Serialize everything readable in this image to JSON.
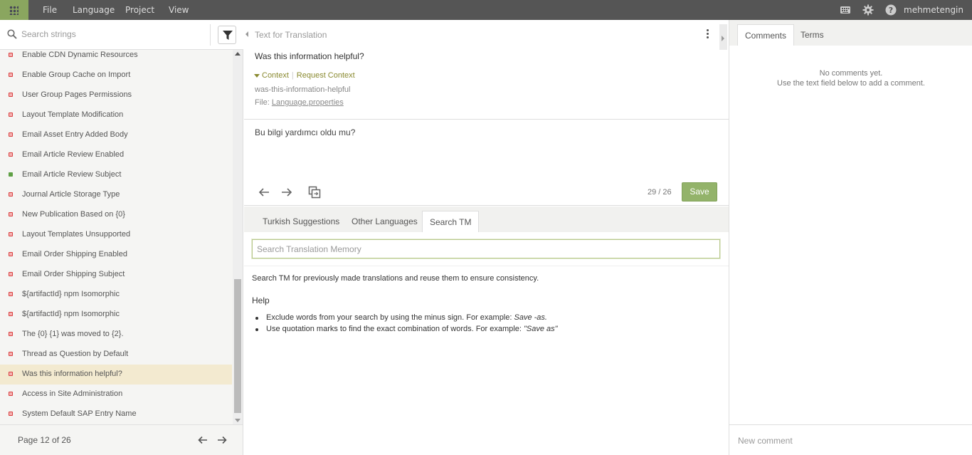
{
  "colors": {
    "topbar": "#555555",
    "accent": "#8aa65f",
    "save": "#93b36a",
    "selected_row": "#f3ead0",
    "untranslated": "#d94040",
    "translated": "#5fa045"
  },
  "menu": {
    "file": "File",
    "language": "Language",
    "project": "Project",
    "view": "View"
  },
  "topbar_icons": [
    "keyboard-icon",
    "gear-icon",
    "help-icon"
  ],
  "user": {
    "name": "mehmetengin"
  },
  "search": {
    "placeholder": "Search strings"
  },
  "strings": [
    {
      "label": "Enable CDN Dynamic Resources",
      "status": "untranslated"
    },
    {
      "label": "Enable Group Cache on Import",
      "status": "untranslated"
    },
    {
      "label": "User Group Pages Permissions",
      "status": "untranslated"
    },
    {
      "label": "Layout Template Modification",
      "status": "untranslated"
    },
    {
      "label": "Email Asset Entry Added Body",
      "status": "untranslated"
    },
    {
      "label": "Email Article Review Enabled",
      "status": "untranslated"
    },
    {
      "label": "Email Article Review Subject",
      "status": "translated"
    },
    {
      "label": "Journal Article Storage Type",
      "status": "untranslated"
    },
    {
      "label": "New Publication Based on {0}",
      "status": "untranslated"
    },
    {
      "label": "Layout Templates Unsupported",
      "status": "untranslated"
    },
    {
      "label": "Email Order Shipping Enabled",
      "status": "untranslated"
    },
    {
      "label": "Email Order Shipping Subject",
      "status": "untranslated"
    },
    {
      "label": "${artifactId} npm Isomorphic",
      "status": "untranslated"
    },
    {
      "label": "${artifactId} npm Isomorphic",
      "status": "untranslated"
    },
    {
      "label": "The {0} {1} was moved to {2}.",
      "status": "untranslated"
    },
    {
      "label": "Thread as Question by Default",
      "status": "untranslated"
    },
    {
      "label": "Was this information helpful?",
      "status": "untranslated",
      "selected": true
    },
    {
      "label": "Access in Site Administration",
      "status": "untranslated"
    },
    {
      "label": "System Default SAP Entry Name",
      "status": "untranslated"
    }
  ],
  "pager": {
    "label": "Page 12 of 26"
  },
  "source": {
    "header": "Text for Translation",
    "text": "Was this information helpful?",
    "context_label": "Context",
    "request_context_label": "Request Context",
    "key": "was-this-information-helpful",
    "file_prefix": "File:",
    "file_name": "Language.properties"
  },
  "translation": {
    "text": "Bu bilgi yardımcı oldu mu?"
  },
  "editor": {
    "counter": "29 / 26",
    "save_label": "Save"
  },
  "tm_tabs": [
    {
      "label": "Turkish Suggestions"
    },
    {
      "label": "Other Languages"
    },
    {
      "label": "Search TM",
      "active": true
    }
  ],
  "tm": {
    "placeholder": "Search Translation Memory",
    "description": "Search TM for previously made translations and reuse them to ensure consistency.",
    "help_title": "Help",
    "help_1_text": "Exclude words from your search by using the minus sign. For example:",
    "help_1_example": "Save -as.",
    "help_2_text": "Use quotation marks to find the exact combination of words. For example:",
    "help_2_example": "\"Save as\""
  },
  "right_tabs": [
    {
      "label": "Comments",
      "active": true
    },
    {
      "label": "Terms"
    }
  ],
  "comments": {
    "empty_line_1": "No comments yet.",
    "empty_line_2": "Use the text field below to add a comment.",
    "placeholder": "New comment"
  }
}
